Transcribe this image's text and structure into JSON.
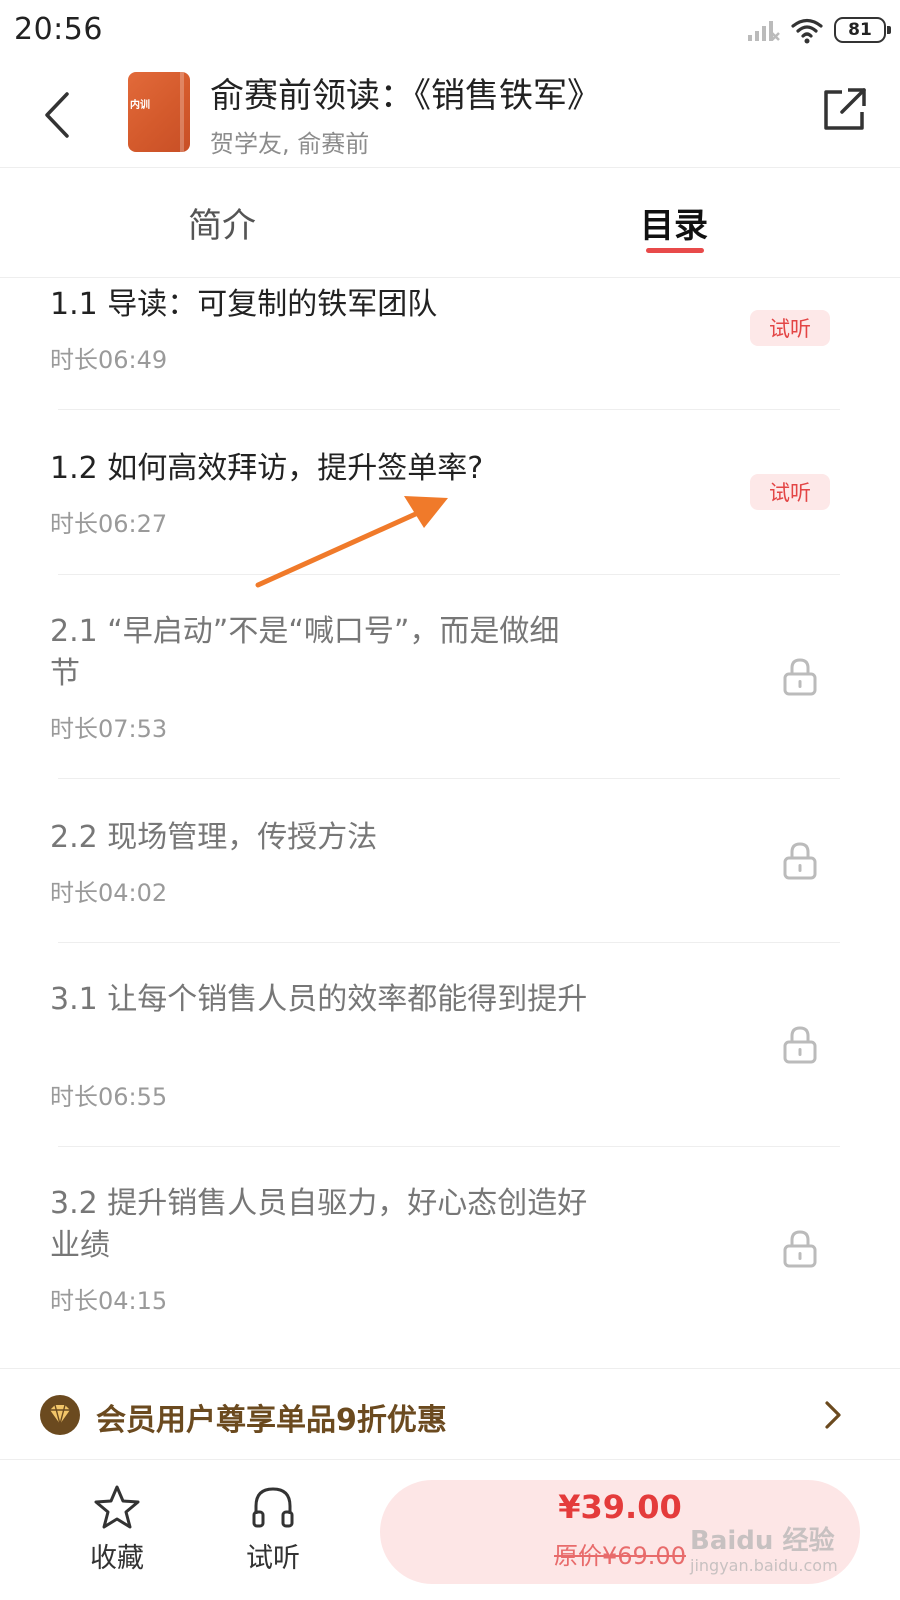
{
  "status_bar": {
    "time": "20:56",
    "battery": "81"
  },
  "header": {
    "title": "俞赛前领读：《销售铁军》",
    "authors": "贺学友, 俞赛前",
    "cover_label": "内训"
  },
  "tabs": [
    {
      "label": "简介",
      "active": false
    },
    {
      "label": "目录",
      "active": true
    }
  ],
  "chapters": [
    {
      "title": "1.1 导读：可复制的铁军团队",
      "duration": "时长06:49",
      "status": "试听"
    },
    {
      "title": "1.2 如何高效拜访，提升签单率?",
      "duration": "时长06:27",
      "status": "试听"
    },
    {
      "title": "2.1 “早启动”不是“喊口号”，而是做细节",
      "duration": "时长07:53",
      "status": "locked"
    },
    {
      "title": "2.2 现场管理，传授方法",
      "duration": "时长04:02",
      "status": "locked"
    },
    {
      "title": "3.1 让每个销售人员的效率都能得到提升",
      "duration": "时长06:55",
      "status": "locked"
    },
    {
      "title": "3.2 提升销售人员自驱力，好心态创造好业绩",
      "duration": "时长04:15",
      "status": "locked"
    }
  ],
  "member_banner": {
    "text": "会员用户尊享单品9折优惠"
  },
  "bottom_bar": {
    "favorite_label": "收藏",
    "listen_label": "试听",
    "price": "¥39.00",
    "original_price": "原价¥69.00"
  },
  "watermark": {
    "brand": "Baidu 经验",
    "url": "jingyan.baidu.com"
  },
  "colors": {
    "accent_red": "#e84a4a",
    "badge_bg": "#fde8e8",
    "member_brown": "#6b4a1f",
    "arrow_orange": "#f07a2a"
  }
}
